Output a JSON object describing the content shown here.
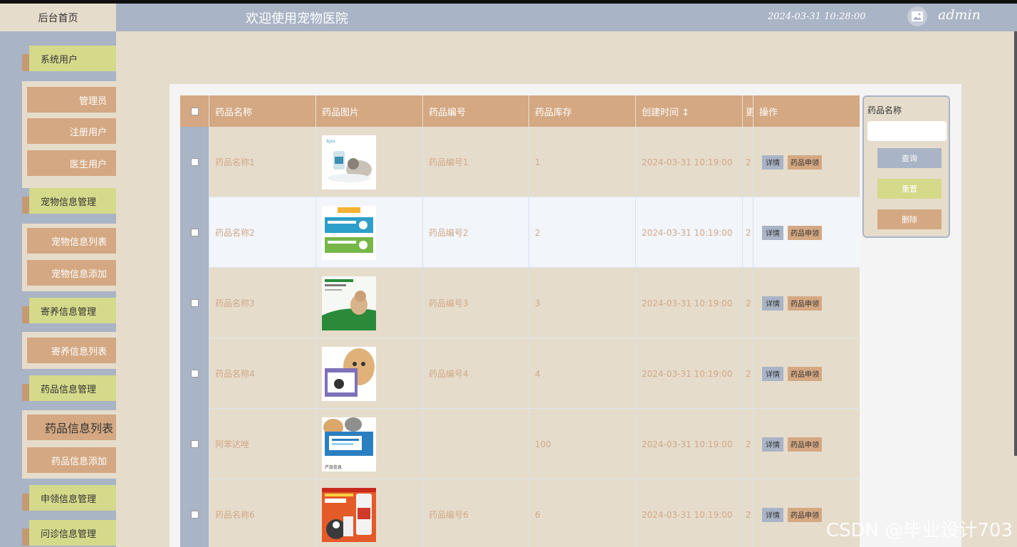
{
  "header": {
    "home": "后台首页",
    "welcome": "欢迎使用宠物医院",
    "datetime": "2024-03-31 10:28:00",
    "username": "admin"
  },
  "sidebar": {
    "groups": [
      {
        "label": "系统用户",
        "items": [
          "管理员",
          "注册用户",
          "医生用户"
        ]
      },
      {
        "label": "宠物信息管理",
        "items": [
          "宠物信息列表",
          "宠物信息添加"
        ]
      },
      {
        "label": "寄养信息管理",
        "items": [
          "寄养信息列表"
        ]
      },
      {
        "label": "药品信息管理",
        "items": [
          "药品信息列表",
          "药品信息添加"
        ]
      },
      {
        "label": "申领信息管理",
        "items": []
      },
      {
        "label": "问诊信息管理",
        "items": []
      }
    ]
  },
  "table": {
    "headers": [
      "药品名称",
      "药品图片",
      "药品编号",
      "药品库存",
      "创建时间 ↕",
      "更",
      "操作"
    ],
    "rows": [
      {
        "name": "药品名称1",
        "code": "药品编号1",
        "stock": "1",
        "created": "2024-03-31 10:19:00",
        "extra": "2"
      },
      {
        "name": "药品名称2",
        "code": "药品编号2",
        "stock": "2",
        "created": "2024-03-31 10:19:00",
        "extra": "2"
      },
      {
        "name": "药品名称3",
        "code": "药品编号3",
        "stock": "3",
        "created": "2024-03-31 10:19:00",
        "extra": "2"
      },
      {
        "name": "药品名称4",
        "code": "药品编号4",
        "stock": "4",
        "created": "2024-03-31 10:19:00",
        "extra": "2"
      },
      {
        "name": "阿苯达唑",
        "code": "",
        "stock": "100",
        "created": "2024-03-31 10:19:00",
        "extra": "2"
      },
      {
        "name": "药品名称6",
        "code": "药品编号6",
        "stock": "6",
        "created": "2024-03-31 10:19:00",
        "extra": "2"
      }
    ],
    "detail_label": "详情",
    "apply_label": "药品申领"
  },
  "search": {
    "label": "药品名称",
    "query": "查询",
    "reset": "重置",
    "delete": "删除"
  },
  "watermark": "CSDN @毕业设计703",
  "colors": {
    "sidebar": "#a9b4c6",
    "accent_tan": "#d4a882",
    "accent_olive": "#d5d98a",
    "background": "#e6dccb"
  }
}
